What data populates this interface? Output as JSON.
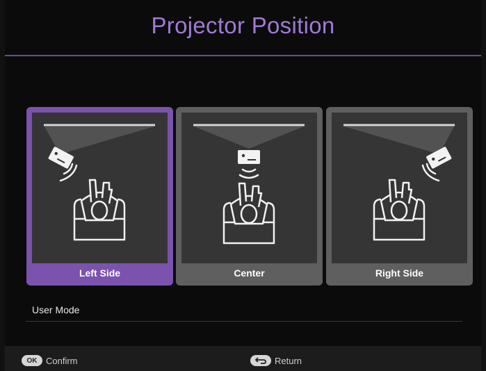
{
  "header": {
    "title": "Projector Position"
  },
  "options": [
    {
      "label": "Left Side",
      "selected": true
    },
    {
      "label": "Center",
      "selected": false
    },
    {
      "label": "Right Side",
      "selected": false
    }
  ],
  "user_mode": {
    "label": "User Mode"
  },
  "footer": {
    "confirm_key": "OK",
    "confirm_label": "Confirm",
    "return_label": "Return"
  },
  "colors": {
    "accent": "#7b52ad",
    "title": "#a07ad6",
    "tile_normal": "#5f5f5f",
    "panel": "#353535"
  },
  "icons": [
    "projector-icon",
    "screen-icon",
    "viewer-icon",
    "signal-icon",
    "return-icon"
  ]
}
